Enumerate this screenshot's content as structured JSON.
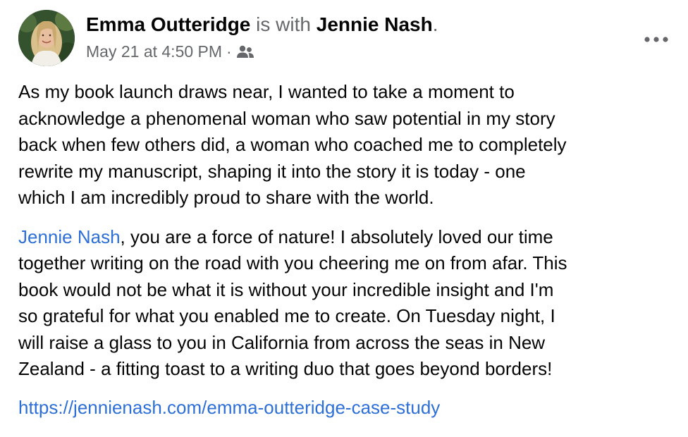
{
  "post": {
    "author_name": "Emma Outteridge",
    "with_text": "is with",
    "tagged_name": "Jennie Nash",
    "period": ".",
    "timestamp": "May 21 at 4:50 PM",
    "separator": "·",
    "audience_icon": "friends-icon",
    "more_icon": "more-options-icon",
    "paragraph_1": "As my book launch draws near, I wanted to take a moment to\nacknowledge a phenomenal woman who saw potential in my story\nback when few others did, a woman who coached me to  completely\nrewrite my manuscript, shaping it into the story it is today - one\nwhich I am incredibly proud to share with the world.",
    "mention": "Jennie Nash",
    "paragraph_2_rest": ", you are a force of nature! I absolutely loved our time\ntogether writing on the road with you cheering me on from afar. This\nbook would not be what it is without your incredible insight and I'm\nso grateful for what you enabled me to create. On Tuesday night, I\nwill raise a glass to you in California from across the seas in New\nZealand - a fitting toast to a writing duo that goes beyond borders!",
    "link_url": "https://jennienash.com/emma-outteridge-case-study"
  },
  "colors": {
    "text": "#050505",
    "muted": "#65676b",
    "link": "#2d6fd6",
    "background": "#ffffff"
  }
}
